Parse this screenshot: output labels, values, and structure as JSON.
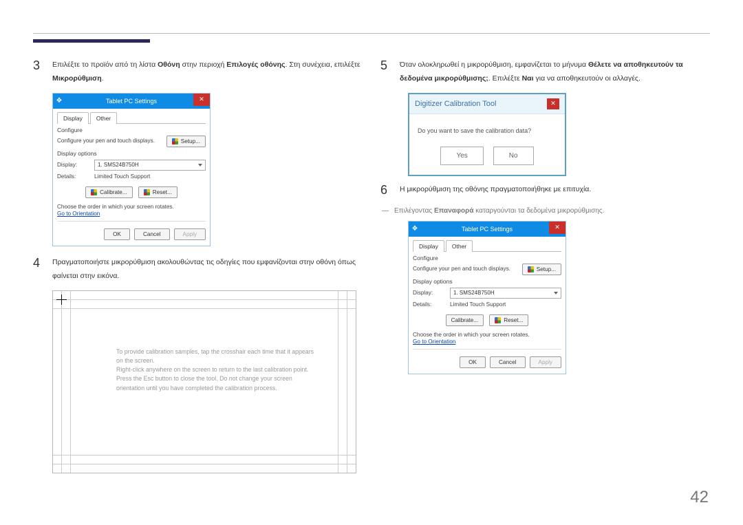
{
  "page_number": "42",
  "left": {
    "step3": {
      "num": "3",
      "t1": "Επιλέξτε το προϊόν από τη λίστα ",
      "b1": "Οθόνη",
      "t2": " στην περιοχή ",
      "b2": "Επιλογές οθόνης",
      "t3": ". Στη συνέχεια, επιλέξτε ",
      "b3": "Μικρορύθμιση",
      "t4": "."
    },
    "dialog": {
      "title": "Tablet PC Settings",
      "tab_display": "Display",
      "tab_other": "Other",
      "configure": "Configure",
      "configure_text": "Configure your pen and touch displays.",
      "setup_btn": "Setup...",
      "disp_options": "Display options",
      "display_lbl": "Display:",
      "display_val": "1. SMS24B750H",
      "details_lbl": "Details:",
      "details_val": "Limited Touch Support",
      "calibrate_btn": "Calibrate...",
      "reset_btn": "Reset...",
      "order_text": "Choose the order in which your screen rotates.",
      "orientation_link": "Go to Orientation",
      "ok": "OK",
      "cancel": "Cancel",
      "apply": "Apply"
    },
    "step4": {
      "num": "4",
      "text": "Πραγματοποιήστε μικρορύθμιση ακολουθώντας τις οδηγίες που εμφανίζονται στην οθόνη όπως φαίνεται στην εικόνα."
    },
    "cal_text": "To provide calibration samples, tap the crosshair each time that it appears on the screen.\nRight-click anywhere on the screen to return to the last calibration point. Press the Esc button to close the tool. Do not change your screen orientation until you have completed the calibration process."
  },
  "right": {
    "step5": {
      "num": "5",
      "t1": "Όταν ολοκληρωθεί η μικρορύθμιση, εμφανίζεται το μήνυμα ",
      "b1": "Θέλετε να αποθηκευτούν τα δεδομένα μικρορύθμισης;",
      "t2": ". Επιλέξτε ",
      "b2": "Ναι",
      "t3": " για να αποθηκευτούν οι αλλαγές."
    },
    "calib": {
      "title": "Digitizer Calibration Tool",
      "body": "Do you want to save the calibration data?",
      "yes": "Yes",
      "no": "No"
    },
    "step6": {
      "num": "6",
      "text": "Η μικρορύθμιση της οθόνης πραγματοποιήθηκε με επιτυχία."
    },
    "note": {
      "t1": "Επιλέγοντας ",
      "b1": "Επαναφορά",
      "t2": " καταργούνται τα δεδομένα μικρορύθμισης."
    }
  }
}
